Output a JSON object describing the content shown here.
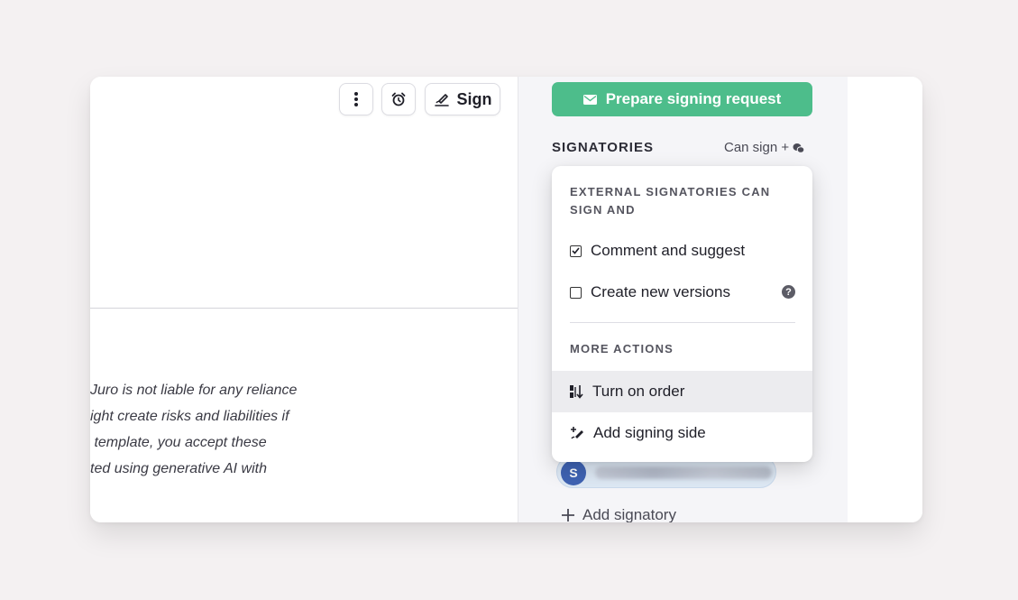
{
  "toolbar": {
    "more_icon": "vertical-dots-icon",
    "alarm_icon": "alarm-clock-icon",
    "sign_icon": "signature-pen-icon",
    "sign_label": "Sign"
  },
  "document": {
    "disclaimer_lines": [
      "Juro is not liable for any reliance",
      "ight create risks and liabilities if",
      " template, you accept these",
      "ted using generative AI with"
    ]
  },
  "panel": {
    "prepare_button_label": "Prepare signing request",
    "prepare_button_icon": "envelope-icon",
    "signatories_title": "SIGNATORIES",
    "can_sign_label": "Can sign +",
    "can_sign_icon": "comments-icon",
    "signatory_avatar_initial": "S",
    "add_signatory_label": "Add signatory"
  },
  "menu": {
    "section1_title": "EXTERNAL SIGNATORIES CAN SIGN AND",
    "options": [
      {
        "label": "Comment and suggest",
        "checked": true
      },
      {
        "label": "Create new versions",
        "checked": false
      }
    ],
    "help_icon": "question-circle-icon",
    "section2_title": "MORE ACTIONS",
    "actions": [
      {
        "label": "Turn on order",
        "icon": "order-sort-icon",
        "highlighted": true
      },
      {
        "label": "Add signing side",
        "icon": "add-signing-side-icon",
        "highlighted": false
      }
    ]
  },
  "colors": {
    "accent_green": "#4dbd8b",
    "avatar_blue": "#3f63b3",
    "page_bg": "#f4f1f2"
  }
}
